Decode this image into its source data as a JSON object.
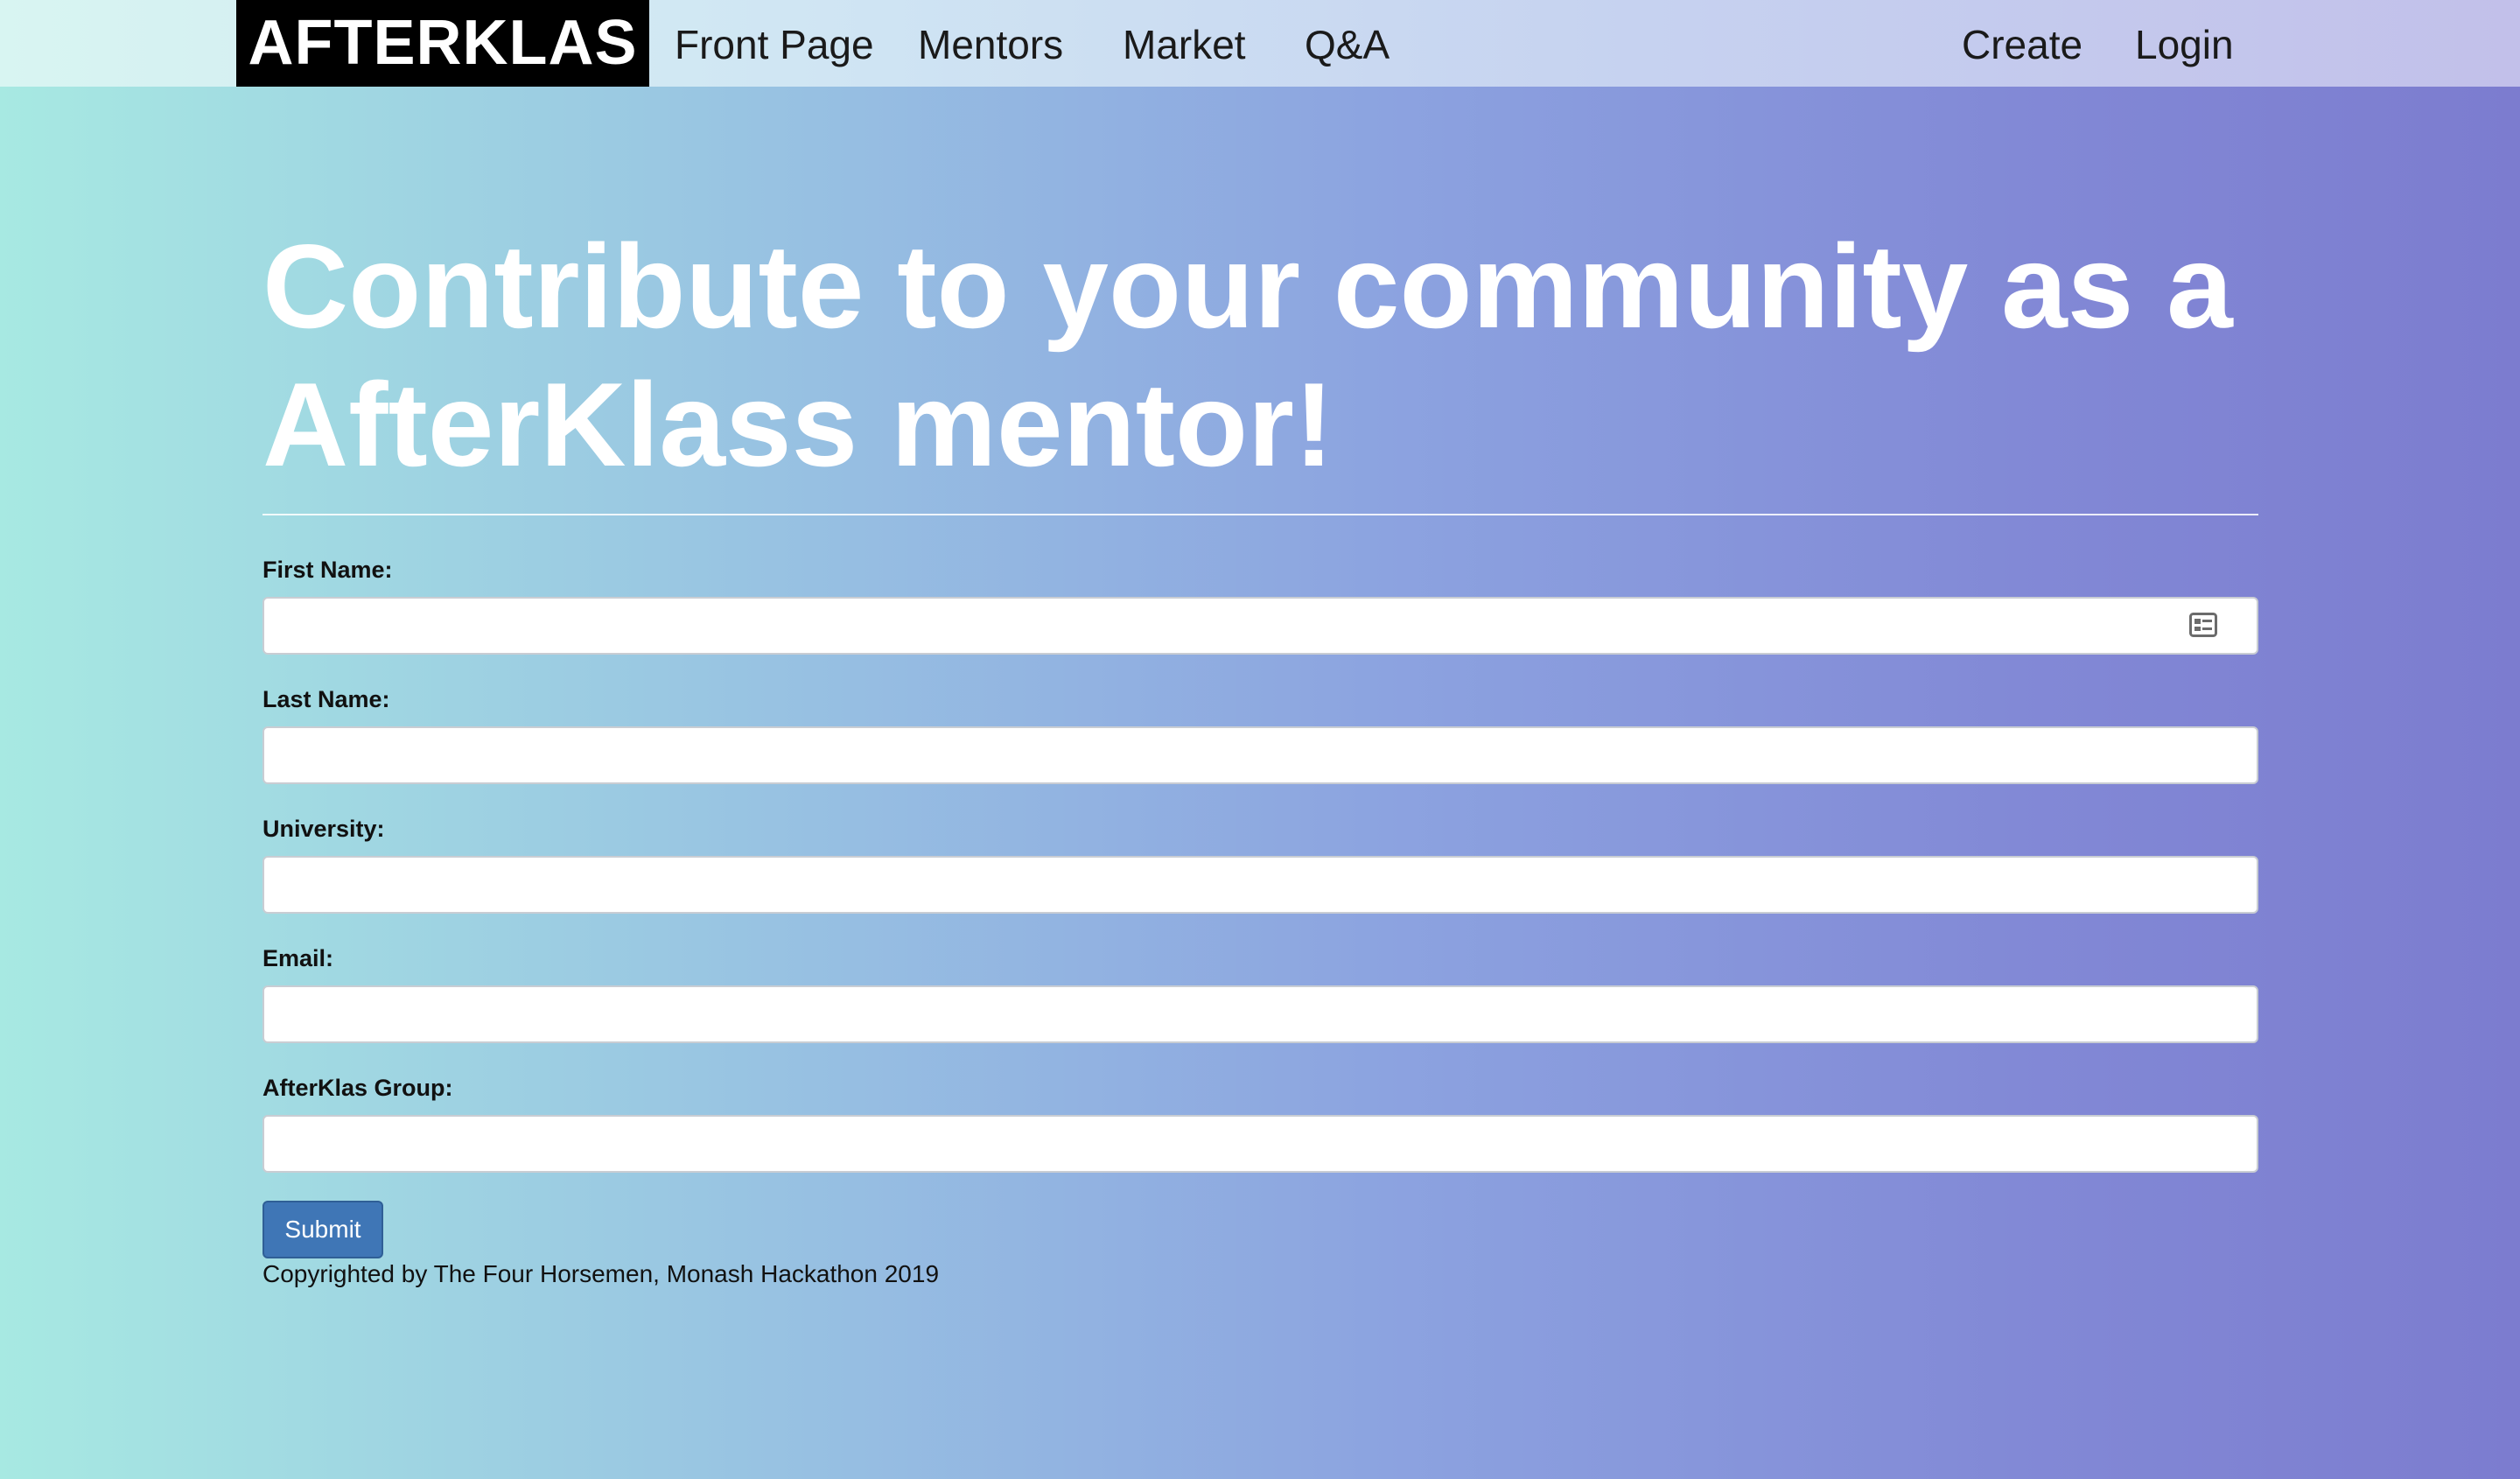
{
  "navbar": {
    "brand": "AFTERKLAS",
    "links": [
      {
        "label": "Front Page"
      },
      {
        "label": "Mentors"
      },
      {
        "label": "Market"
      },
      {
        "label": "Q&A"
      }
    ],
    "right_links": [
      {
        "label": "Create"
      },
      {
        "label": "Login"
      }
    ]
  },
  "main": {
    "headline_line1": "Contribute to your community as a",
    "headline_line2": "AfterKlass mentor!",
    "form": {
      "fields": [
        {
          "label": "First Name:",
          "value": "",
          "icon": "contact-card-icon"
        },
        {
          "label": "Last Name:",
          "value": ""
        },
        {
          "label": "University:",
          "value": ""
        },
        {
          "label": "Email:",
          "value": ""
        },
        {
          "label": "AfterKlas Group:",
          "value": ""
        }
      ],
      "submit_label": "Submit"
    },
    "footer": "Copyrighted by The Four Horsemen, Monash Hackathon 2019"
  },
  "colors": {
    "submit": "#3f76b6",
    "brand_bg": "#000000"
  }
}
